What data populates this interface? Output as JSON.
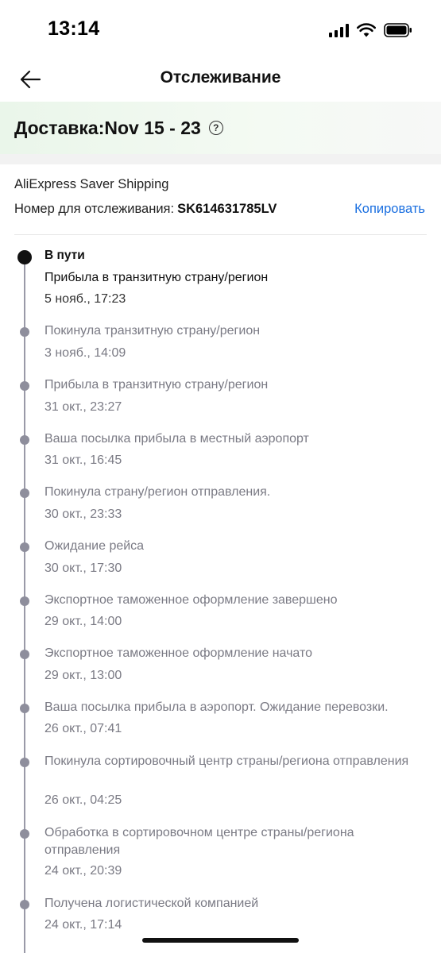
{
  "status_bar": {
    "time": "13:14"
  },
  "header": {
    "title": "Отслеживание"
  },
  "delivery": {
    "text": "Доставка:Nov 15 - 23"
  },
  "shipping": {
    "method": "AliExpress Saver Shipping",
    "tracking_label": "Номер для отслеживания:",
    "tracking_number": "SK614631785LV",
    "copy_label": "Копировать"
  },
  "timeline": {
    "current_status": "В пути",
    "events": [
      {
        "title": "Прибыла в транзитную страну/регион",
        "date": "5 нояб., 17:23"
      },
      {
        "title": "Покинула транзитную страну/регион",
        "date": "3 нояб., 14:09"
      },
      {
        "title": "Прибыла в транзитную страну/регион",
        "date": "31 окт., 23:27"
      },
      {
        "title": "Ваша посылка прибыла в местный аэропорт",
        "date": "31 окт., 16:45"
      },
      {
        "title": "Покинула страну/регион отправления.",
        "date": "30 окт., 23:33"
      },
      {
        "title": "Ожидание рейса",
        "date": "30 окт., 17:30"
      },
      {
        "title": "Экспортное таможенное оформление завершено",
        "date": "29 окт., 14:00"
      },
      {
        "title": "Экспортное таможенное оформление начато",
        "date": "29 окт., 13:00"
      },
      {
        "title": "Ваша посылка прибыла в аэропорт. Ожидание перевозки.",
        "date": "26 окт., 07:41"
      },
      {
        "title": "Покинула сортировочный центр страны/региона отправления",
        "date": "26 окт., 04:25"
      },
      {
        "title": "Обработка в сортировочном центре страны/региона отправления",
        "date": "24 окт., 20:39"
      },
      {
        "title": "Получена логистической компанией",
        "date": "24 окт., 17:14"
      }
    ]
  }
}
